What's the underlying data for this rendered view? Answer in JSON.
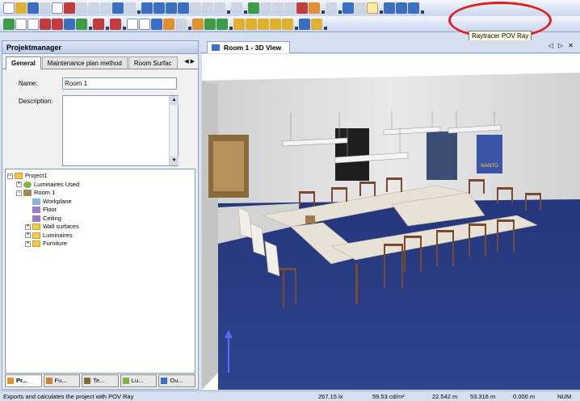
{
  "toolbar": {
    "highlighted_button": "raytracer-pov-ray-button",
    "tooltip": "Raytracer POV Ray"
  },
  "left_panel": {
    "title": "Projektmanager",
    "tabs": [
      "General",
      "Maintenance plan method",
      "Room Surfac"
    ],
    "tab_scroll": "◀ ▶",
    "name_label": "Name:",
    "name_value": "Room 1",
    "description_label": "Description:",
    "tree": {
      "project": "Project1",
      "luminaires_used": "Luminaires Used",
      "room": "Room 1",
      "workplane": "Workplane",
      "floor": "Floor",
      "ceiling": "Ceiling",
      "wall_surfaces": "Wall surfaces",
      "luminaires": "Luminaires",
      "furniture": "Furniture"
    },
    "bottom_tabs": [
      "Pr...",
      "Fu...",
      "Te...",
      "Lu...",
      "Ou..."
    ]
  },
  "view": {
    "tab_title": "Room 1 - 3D View",
    "controls": "◁ ▷ ✕",
    "painting_label": "MANTO"
  },
  "status": {
    "message": "Exports and calculates the project with POV Ray",
    "illuminance": "267.15 lx",
    "luminance": "59.53 cd/m²",
    "x": "22.542 m",
    "y": "53.316 m",
    "z": "0.000 m",
    "num": "NUM"
  },
  "colors": {
    "carpet": "#2b3d86",
    "wall": "#dcdcdc",
    "table": "#e8e2d6",
    "chair": "#7a4a2e",
    "highlight": "#e02020"
  }
}
